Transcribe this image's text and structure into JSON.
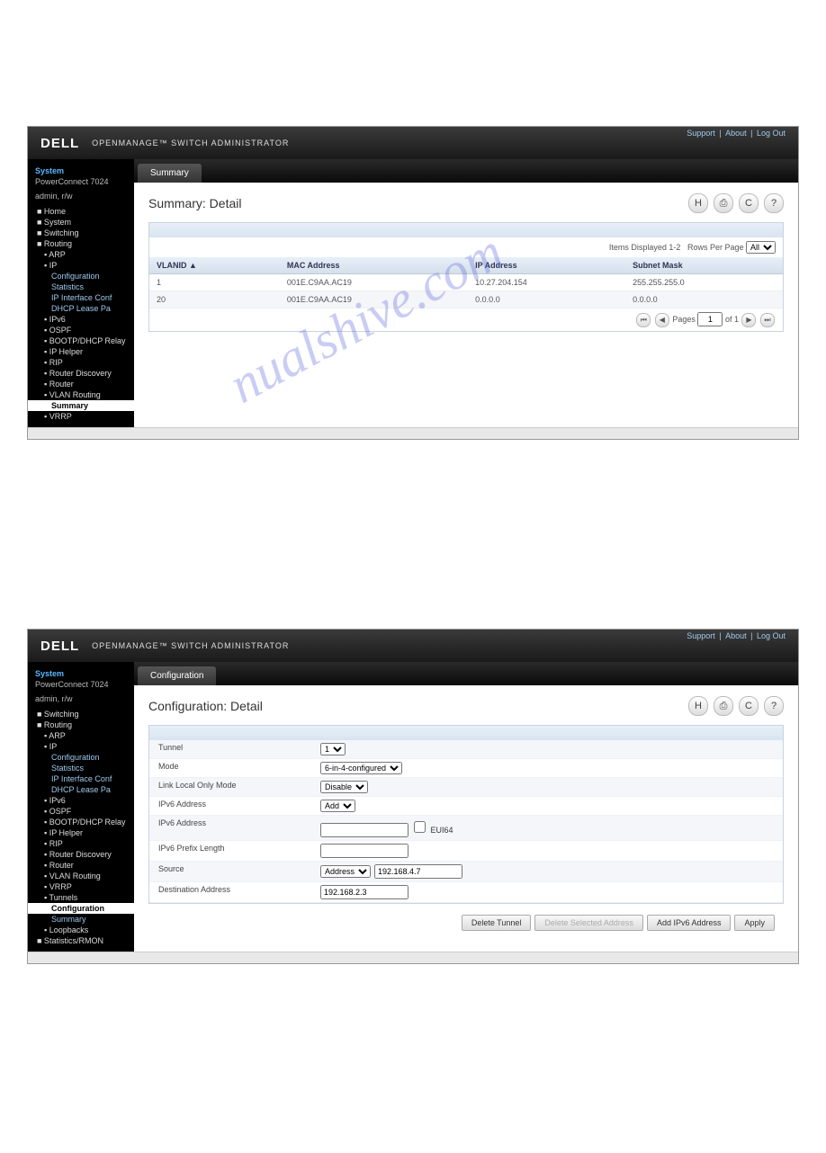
{
  "header": {
    "brand": "DELL",
    "title": "OPENMANAGE™ SWITCH ADMINISTRATOR",
    "links": [
      "Support",
      "About",
      "Log Out"
    ]
  },
  "system": {
    "title": "System",
    "model": "PowerConnect 7024",
    "user": "admin, r/w"
  },
  "tree1": [
    {
      "l": "Home",
      "d": 0
    },
    {
      "l": "System",
      "d": 0
    },
    {
      "l": "Switching",
      "d": 0
    },
    {
      "l": "Routing",
      "d": 0
    },
    {
      "l": "ARP",
      "d": 1
    },
    {
      "l": "IP",
      "d": 1
    },
    {
      "l": "Configuration",
      "d": 2,
      "link": 1
    },
    {
      "l": "Statistics",
      "d": 2,
      "link": 1
    },
    {
      "l": "IP Interface Conf",
      "d": 2,
      "link": 1
    },
    {
      "l": "DHCP Lease Pa",
      "d": 2,
      "link": 1
    },
    {
      "l": "IPv6",
      "d": 1
    },
    {
      "l": "OSPF",
      "d": 1
    },
    {
      "l": "BOOTP/DHCP Relay",
      "d": 1
    },
    {
      "l": "IP Helper",
      "d": 1
    },
    {
      "l": "RIP",
      "d": 1
    },
    {
      "l": "Router Discovery",
      "d": 1
    },
    {
      "l": "Router",
      "d": 1
    },
    {
      "l": "VLAN Routing",
      "d": 1
    },
    {
      "l": "Summary",
      "d": 2,
      "sel": 1
    },
    {
      "l": "VRRP",
      "d": 1
    }
  ],
  "tree2": [
    {
      "l": "Switching",
      "d": 0
    },
    {
      "l": "Routing",
      "d": 0
    },
    {
      "l": "ARP",
      "d": 1
    },
    {
      "l": "IP",
      "d": 1
    },
    {
      "l": "Configuration",
      "d": 2,
      "link": 1
    },
    {
      "l": "Statistics",
      "d": 2,
      "link": 1
    },
    {
      "l": "IP Interface Conf",
      "d": 2,
      "link": 1
    },
    {
      "l": "DHCP Lease Pa",
      "d": 2,
      "link": 1
    },
    {
      "l": "IPv6",
      "d": 1
    },
    {
      "l": "OSPF",
      "d": 1
    },
    {
      "l": "BOOTP/DHCP Relay",
      "d": 1
    },
    {
      "l": "IP Helper",
      "d": 1
    },
    {
      "l": "RIP",
      "d": 1
    },
    {
      "l": "Router Discovery",
      "d": 1
    },
    {
      "l": "Router",
      "d": 1
    },
    {
      "l": "VLAN Routing",
      "d": 1
    },
    {
      "l": "VRRP",
      "d": 1
    },
    {
      "l": "Tunnels",
      "d": 1
    },
    {
      "l": "Configuration",
      "d": 2,
      "sel": 1
    },
    {
      "l": "Summary",
      "d": 2,
      "link": 1
    },
    {
      "l": "Loopbacks",
      "d": 1
    },
    {
      "l": "Statistics/RMON",
      "d": 0
    }
  ],
  "panel1": {
    "tab": "Summary",
    "title": "Summary: Detail",
    "items_disp": "Items Displayed 1-2",
    "rows_per": "Rows Per Page",
    "rows_per_val": "All",
    "cols": [
      "VLANID ▲",
      "MAC Address",
      "IP Address",
      "Subnet Mask"
    ],
    "rows": [
      [
        "1",
        "001E.C9AA.AC19",
        "10.27.204.154",
        "255.255.255.0"
      ],
      [
        "20",
        "001E.C9AA.AC19",
        "0.0.0.0",
        "0.0.0.0"
      ]
    ],
    "pager": {
      "label": "Pages",
      "val": "1",
      "of": "of 1"
    }
  },
  "panel2": {
    "tab": "Configuration",
    "title": "Configuration: Detail",
    "fields": [
      {
        "label": "Tunnel",
        "type": "select",
        "val": "1"
      },
      {
        "label": "Mode",
        "type": "select",
        "val": "6-in-4-configured"
      },
      {
        "label": "Link Local Only Mode",
        "type": "select",
        "val": "Disable"
      },
      {
        "label": "IPv6 Address",
        "type": "select",
        "val": "Add"
      },
      {
        "label": "IPv6 Address",
        "type": "text_eui",
        "val": "",
        "eui": "EUI64"
      },
      {
        "label": "IPv6 Prefix Length",
        "type": "text",
        "val": ""
      },
      {
        "label": "Source",
        "type": "sel_text",
        "sel": "Address",
        "val": "192.168.4.7"
      },
      {
        "label": "Destination Address",
        "type": "text",
        "val": "192.168.2.3"
      }
    ],
    "buttons": [
      {
        "l": "Delete Tunnel",
        "d": 0
      },
      {
        "l": "Delete Selected Address",
        "d": 1
      },
      {
        "l": "Add IPv6 Address",
        "d": 0
      },
      {
        "l": "Apply",
        "d": 0
      }
    ]
  },
  "icons": [
    "H",
    "⎙",
    "C",
    "?"
  ],
  "watermark": "nualshive.com"
}
